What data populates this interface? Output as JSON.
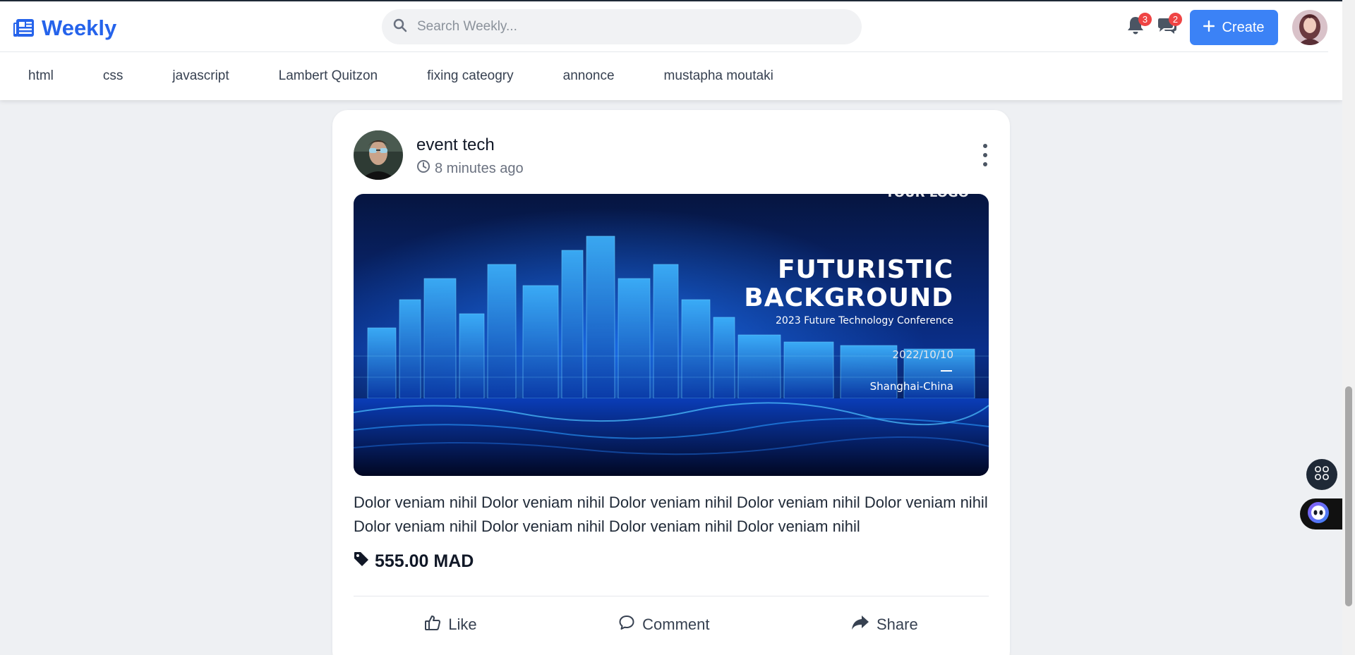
{
  "header": {
    "brand_name": "Weekly",
    "search_placeholder": "Search Weekly...",
    "notifications_count": "3",
    "messages_count": "2",
    "create_label": "Create"
  },
  "categories": [
    "html",
    "css",
    "javascript",
    "Lambert Quitzon",
    "fixing cateogry",
    "annonce",
    "mustapha moutaki"
  ],
  "post": {
    "author": "event tech",
    "time": "8 minutes ago",
    "image": {
      "logo_text": "YOUR LOGO",
      "title_line1": "FUTURISTIC",
      "title_line2": "BACKGROUND",
      "subtitle": "2023 Future Technology  Conference",
      "date": "2022/10/10",
      "location": "Shanghai-China"
    },
    "body": "Dolor veniam nihil Dolor veniam nihil Dolor veniam nihil Dolor veniam nihil Dolor veniam nihil Dolor veniam nihil Dolor veniam nihil Dolor veniam nihil Dolor veniam nihil",
    "price": "555.00 MAD",
    "actions": {
      "like": "Like",
      "comment": "Comment",
      "share": "Share"
    }
  },
  "colors": {
    "brand": "#2563eb",
    "create_button": "#3b82f6",
    "badge": "#ef4444",
    "page_background": "#eef0f3"
  }
}
